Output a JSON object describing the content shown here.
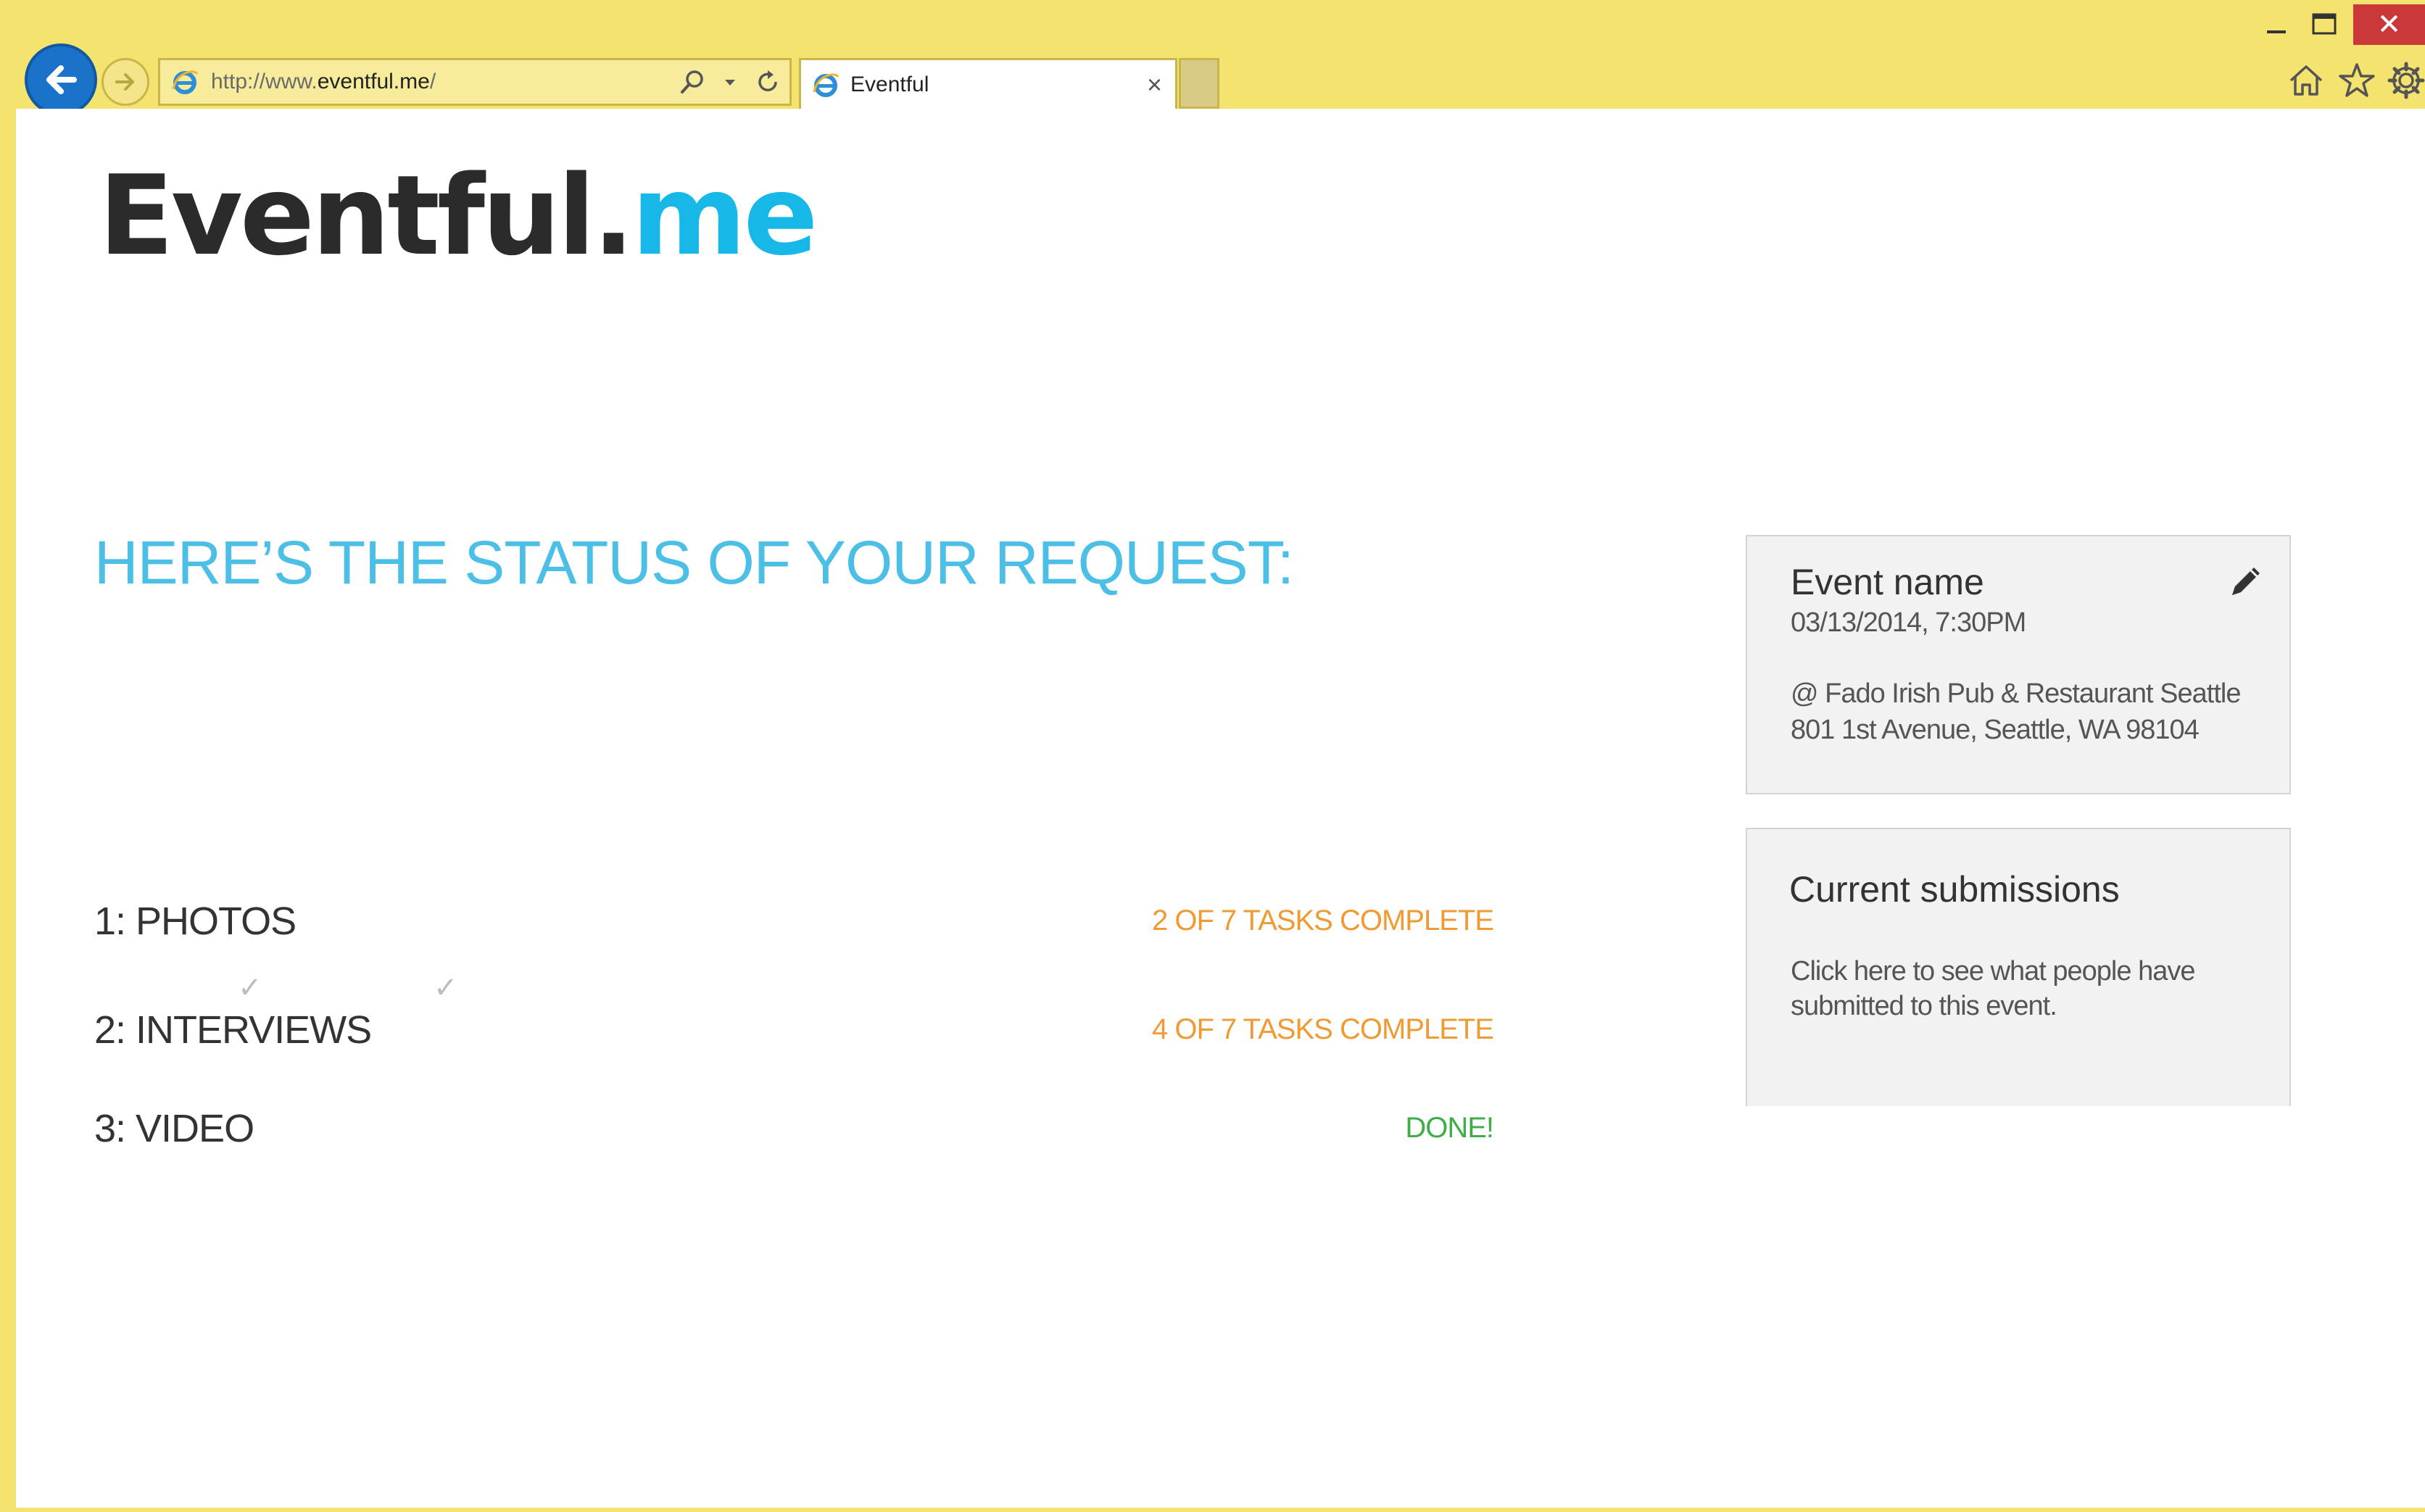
{
  "browser": {
    "url_prefix": "http://www.",
    "url_host": "eventful.me",
    "url_suffix": "/",
    "tab_title": "Eventful",
    "tab_close": "×",
    "icons": [
      "back-arrow-icon",
      "forward-arrow-icon",
      "ie-logo-icon",
      "search-icon",
      "dropdown-icon",
      "refresh-icon",
      "home-icon",
      "star-icon",
      "gear-icon",
      "minimize-icon",
      "maximize-icon",
      "close-icon"
    ],
    "close_symbol": "✕"
  },
  "logo": {
    "main": "Eventful.",
    "accent": "me",
    "accent_color": "#17b8e8"
  },
  "status": {
    "heading": "HERE’S THE STATUS OF YOUR REQUEST:",
    "tasks": [
      {
        "label": "1: PHOTOS",
        "status": "2 OF 7 TASKS COMPLETE",
        "color": "#ef9a32"
      },
      {
        "label": "2: INTERVIEWS",
        "status": "4 OF 7 TASKS COMPLETE",
        "color": "#ef9a32"
      },
      {
        "label": "3: VIDEO",
        "status": "DONE!",
        "color": "#3fae49"
      }
    ],
    "checkmark": "✓"
  },
  "event_card": {
    "name": "Event name",
    "datetime": "03/13/2014, 7:30PM",
    "venue": "@ Fado Irish Pub & Restaurant Seattle",
    "address": "801 1st Avenue, Seattle, WA 98104",
    "edit_icon": "pencil-icon"
  },
  "submissions_card": {
    "title": "Current submissions",
    "description": "Click here to see what people have submitted to this event."
  }
}
